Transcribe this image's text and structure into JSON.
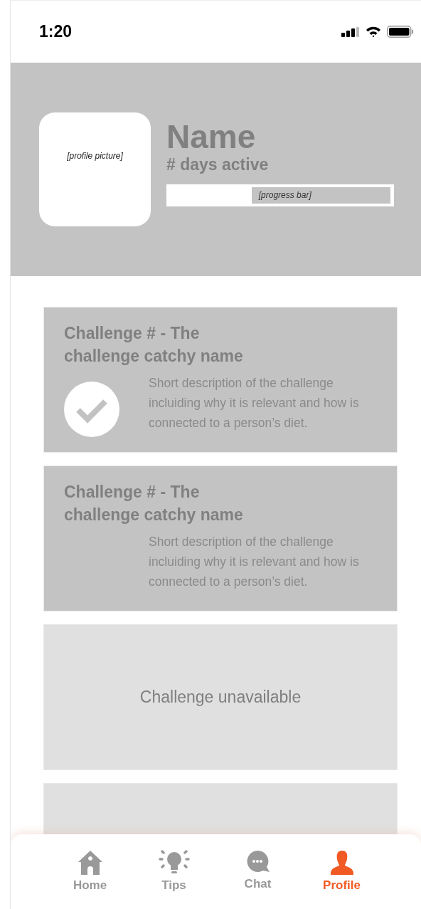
{
  "status_bar": {
    "time": "1:20"
  },
  "profile": {
    "picture_label": "[profile picture]",
    "name": "Name",
    "days_active": "# days active",
    "progress": {
      "label": "[progress bar]",
      "level": 0.63
    }
  },
  "challenges": [
    {
      "kind": "challenge",
      "title": "Challenge # - The challenge catchy name",
      "description": "Short description of the challenge incluiding why it is relevant and how is connected to a person’s diet.",
      "completed": true
    },
    {
      "kind": "challenge",
      "title": "Challenge # - The challenge catchy name",
      "description": "Short description of the challenge incluiding why it is relevant and how is connected to a person’s diet.",
      "completed": false
    },
    {
      "kind": "unavailable",
      "text": "Challenge unavailable"
    },
    {
      "kind": "blank"
    }
  ],
  "tab_bar": [
    {
      "kind": "home",
      "label": "Home",
      "selected": false
    },
    {
      "kind": "tips",
      "label": "Tips",
      "selected": false
    },
    {
      "kind": "chat",
      "label": "Chat",
      "selected": false
    },
    {
      "kind": "profile",
      "label": "Profile",
      "selected": true
    }
  ]
}
